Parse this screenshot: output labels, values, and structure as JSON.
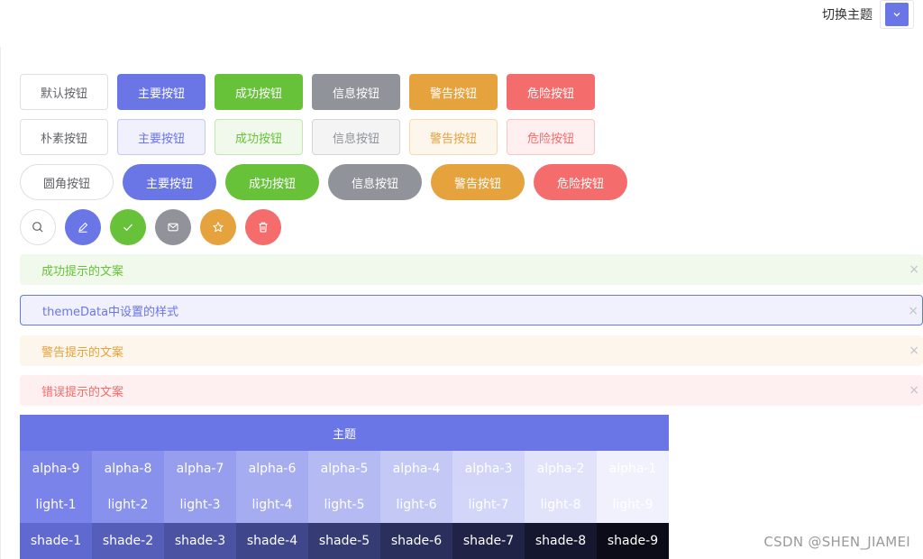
{
  "topbar": {
    "label": "切换主题"
  },
  "buttons": {
    "row1": [
      "默认按钮",
      "主要按钮",
      "成功按钮",
      "信息按钮",
      "警告按钮",
      "危险按钮"
    ],
    "row2": [
      "朴素按钮",
      "主要按钮",
      "成功按钮",
      "信息按钮",
      "警告按钮",
      "危险按钮"
    ],
    "row3": [
      "圆角按钮",
      "主要按钮",
      "成功按钮",
      "信息按钮",
      "警告按钮",
      "危险按钮"
    ]
  },
  "icons": [
    "search-icon",
    "edit-icon",
    "check-icon",
    "message-icon",
    "star-icon",
    "delete-icon"
  ],
  "alerts": {
    "success": "成功提示的文案",
    "theme": "themeData中设置的样式",
    "warning": "警告提示的文案",
    "error": "错误提示的文案",
    "close": "×"
  },
  "palette": {
    "title": "主题",
    "alpha": [
      "alpha-9",
      "alpha-8",
      "alpha-7",
      "alpha-6",
      "alpha-5",
      "alpha-4",
      "alpha-3",
      "alpha-2",
      "alpha-1"
    ],
    "light": [
      "light-1",
      "light-2",
      "light-3",
      "light-4",
      "light-5",
      "light-6",
      "light-7",
      "light-8",
      "light-9"
    ],
    "shade": [
      "shade-1",
      "shade-2",
      "shade-3",
      "shade-4",
      "shade-5",
      "shade-6",
      "shade-7",
      "shade-8",
      "shade-9"
    ]
  },
  "colors": {
    "primary": "#6a75e6",
    "success": "#67c23a",
    "info": "#909399",
    "warning": "#e6a23c",
    "danger": "#f56c6c"
  },
  "watermark": "CSDN @SHEN_JIAMEI"
}
